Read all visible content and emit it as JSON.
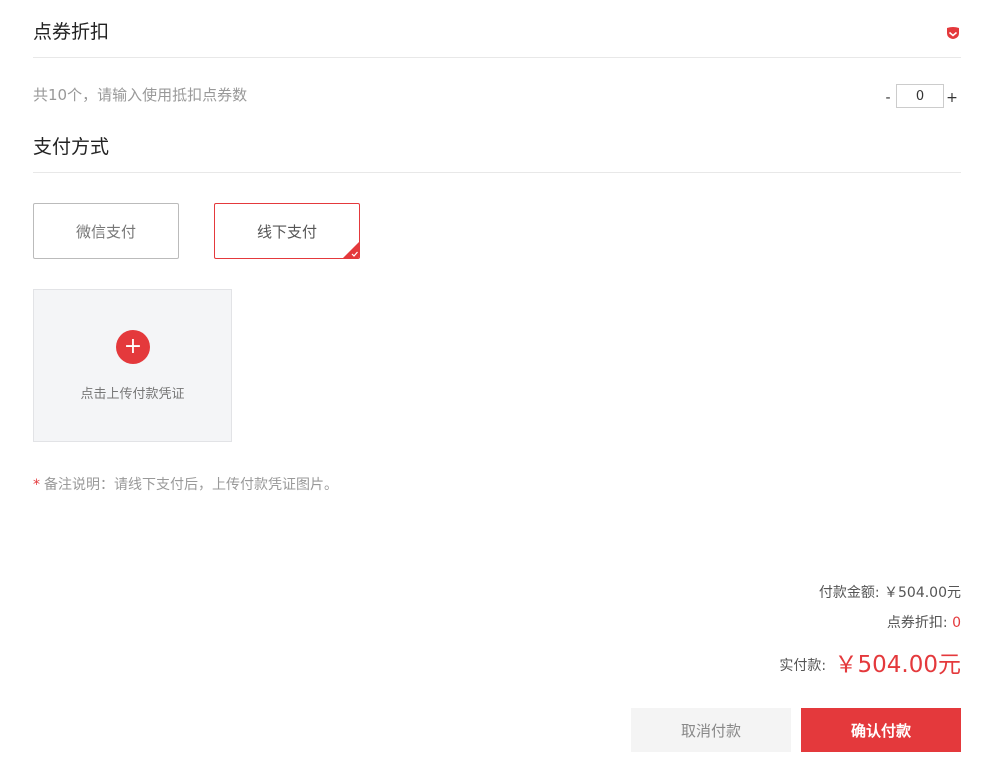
{
  "discount_section": {
    "title": "点券折扣",
    "hint": "共10个，请输入使用抵扣点券数",
    "stepper": {
      "minus": "-",
      "value": "0",
      "plus": "+"
    }
  },
  "payment_section": {
    "title": "支付方式",
    "options": [
      {
        "label": "微信支付",
        "selected": false
      },
      {
        "label": "线下支付",
        "selected": true
      }
    ],
    "upload_label": "点击上传付款凭证",
    "note_star": "*",
    "note": "备注说明：请线下支付后，上传付款凭证图片。"
  },
  "summary": {
    "amount_label": "付款金额:",
    "amount_value": "￥504.00元",
    "discount_label": "点券折扣:",
    "discount_value": "0",
    "actual_label": "实付款:",
    "actual_value": "￥504.00元"
  },
  "buttons": {
    "cancel": "取消付款",
    "confirm": "确认付款"
  },
  "colors": {
    "accent": "#e4393c",
    "muted": "#999999",
    "cancel_bg": "#f4f4f4"
  },
  "icons": {
    "toggle": "red-toggle-icon",
    "upload": "plus-icon",
    "selected_marker": "check-corner-icon"
  }
}
